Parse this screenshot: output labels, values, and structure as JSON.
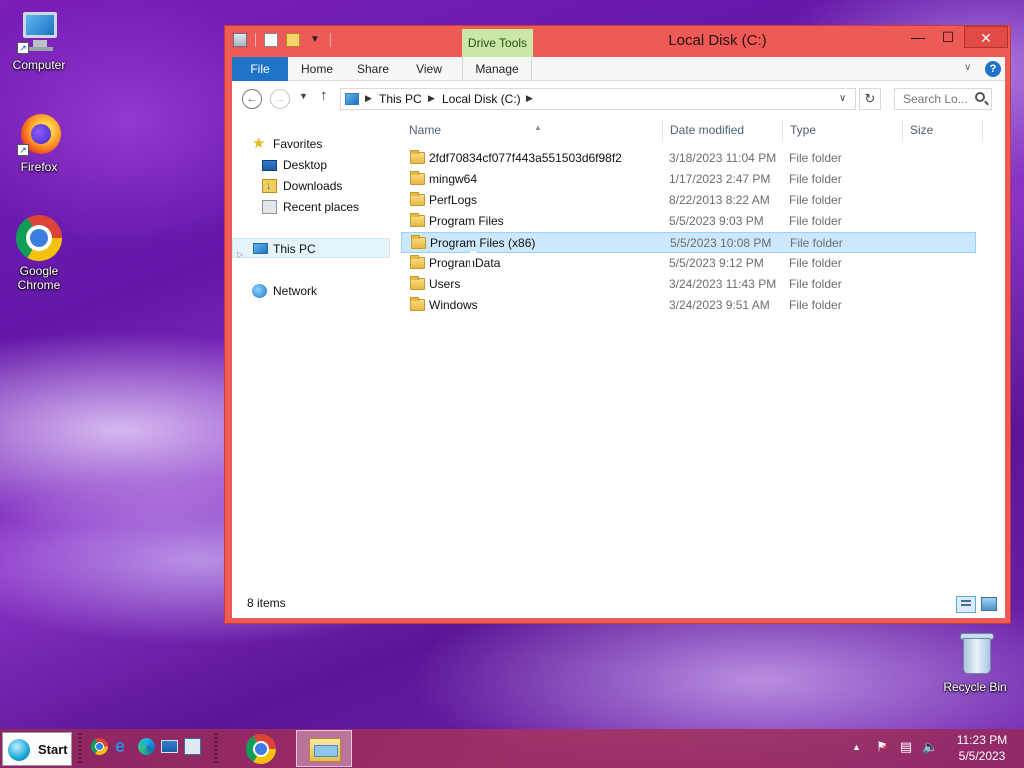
{
  "desktop": {
    "icons": [
      {
        "label": "Computer",
        "icon": "computer-icon"
      },
      {
        "label": "Firefox",
        "icon": "firefox-icon"
      },
      {
        "label": "Google Chrome",
        "icon": "chrome-icon"
      },
      {
        "label": "Recycle Bin",
        "icon": "recycle-bin-icon"
      }
    ]
  },
  "window": {
    "title": "Local Disk (C:)",
    "contextual_tab": "Drive Tools",
    "controls": {
      "minimize": "—",
      "maximize": "☐",
      "close": "✕"
    },
    "accent_color": "#ee5a55",
    "ribbon_tabs": [
      "File",
      "Home",
      "Share",
      "View",
      "Manage"
    ]
  },
  "address": {
    "breadcrumbs": [
      "This PC",
      "Local Disk (C:)"
    ],
    "search_placeholder": "Search Lo..."
  },
  "navpane": {
    "items": [
      {
        "label": "Favorites",
        "icon": "star-icon"
      },
      {
        "label": "Desktop",
        "icon": "desktop-folder-icon"
      },
      {
        "label": "Downloads",
        "icon": "downloads-icon"
      },
      {
        "label": "Recent places",
        "icon": "recent-places-icon"
      },
      {
        "label": "This PC",
        "icon": "this-pc-icon",
        "selected": true
      },
      {
        "label": "Network",
        "icon": "network-icon"
      }
    ]
  },
  "filelist": {
    "columns": [
      "Name",
      "Date modified",
      "Type",
      "Size"
    ],
    "rows": [
      {
        "name": "2fdf70834cf077f443a551503d6f98f2",
        "date": "3/18/2023 11:04 PM",
        "type": "File folder"
      },
      {
        "name": "mingw64",
        "date": "1/17/2023 2:47 PM",
        "type": "File folder"
      },
      {
        "name": "PerfLogs",
        "date": "8/22/2013 8:22 AM",
        "type": "File folder"
      },
      {
        "name": "Program Files",
        "date": "5/5/2023 9:03 PM",
        "type": "File folder"
      },
      {
        "name": "Program Files (x86)",
        "date": "5/5/2023 10:08 PM",
        "type": "File folder",
        "selected": true
      },
      {
        "name": "ProgramData",
        "date": "5/5/2023 9:12 PM",
        "type": "File folder"
      },
      {
        "name": "Users",
        "date": "3/24/2023 11:43 PM",
        "type": "File folder"
      },
      {
        "name": "Windows",
        "date": "3/24/2023 9:51 AM",
        "type": "File folder"
      }
    ]
  },
  "statusbar": {
    "item_count": "8 items"
  },
  "taskbar": {
    "start_label": "Start",
    "quick_launch": [
      "chrome-icon",
      "internet-explorer-icon",
      "edge-icon",
      "show-desktop-icon",
      "remote-desktop-icon"
    ],
    "apps": [
      "chrome-icon",
      "file-explorer-icon"
    ],
    "clock_time": "11:23 PM",
    "clock_date": "5/5/2023"
  }
}
